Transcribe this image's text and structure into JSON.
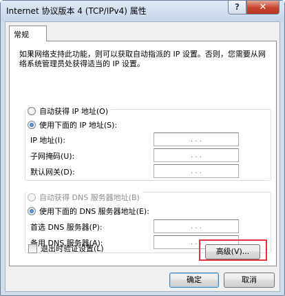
{
  "window": {
    "title": "Internet 协议版本 4 (TCP/IPv4) 属性",
    "help_label": "?",
    "close_label": "✕"
  },
  "tabs": [
    {
      "label": "常规",
      "active": true
    }
  ],
  "intro_text": "如果网络支持此功能，则可以获取自动指派的 IP 设置。否则，您需要从网络系统管理员处获得适当的 IP 设置。",
  "ip_section": {
    "auto_label": "自动获得 IP 地址(O)",
    "manual_label": "使用下面的 IP 地址(S):",
    "selected": "manual",
    "fields": [
      {
        "label": "IP 地址(I):",
        "value": ". . ."
      },
      {
        "label": "子网掩码(U):",
        "value": ". . ."
      },
      {
        "label": "默认网关(D):",
        "value": ". . ."
      }
    ]
  },
  "dns_section": {
    "auto_label": "自动获得 DNS 服务器地址(B)",
    "auto_disabled": true,
    "manual_label": "使用下面的 DNS 服务器地址(E):",
    "selected": "manual",
    "fields": [
      {
        "label": "首选 DNS 服务器(P):",
        "value": ". . ."
      },
      {
        "label": "备用 DNS 服务器(A):",
        "value": ". . ."
      }
    ]
  },
  "validate_on_exit": {
    "label": "退出时验证设置(L)",
    "checked": false
  },
  "buttons": {
    "advanced": "高级(V)...",
    "ok": "确定",
    "cancel": "取消"
  },
  "colors": {
    "highlight_border": "#e0333d",
    "close_button": "#c7432e",
    "default_button_border": "#3c7fb1"
  }
}
